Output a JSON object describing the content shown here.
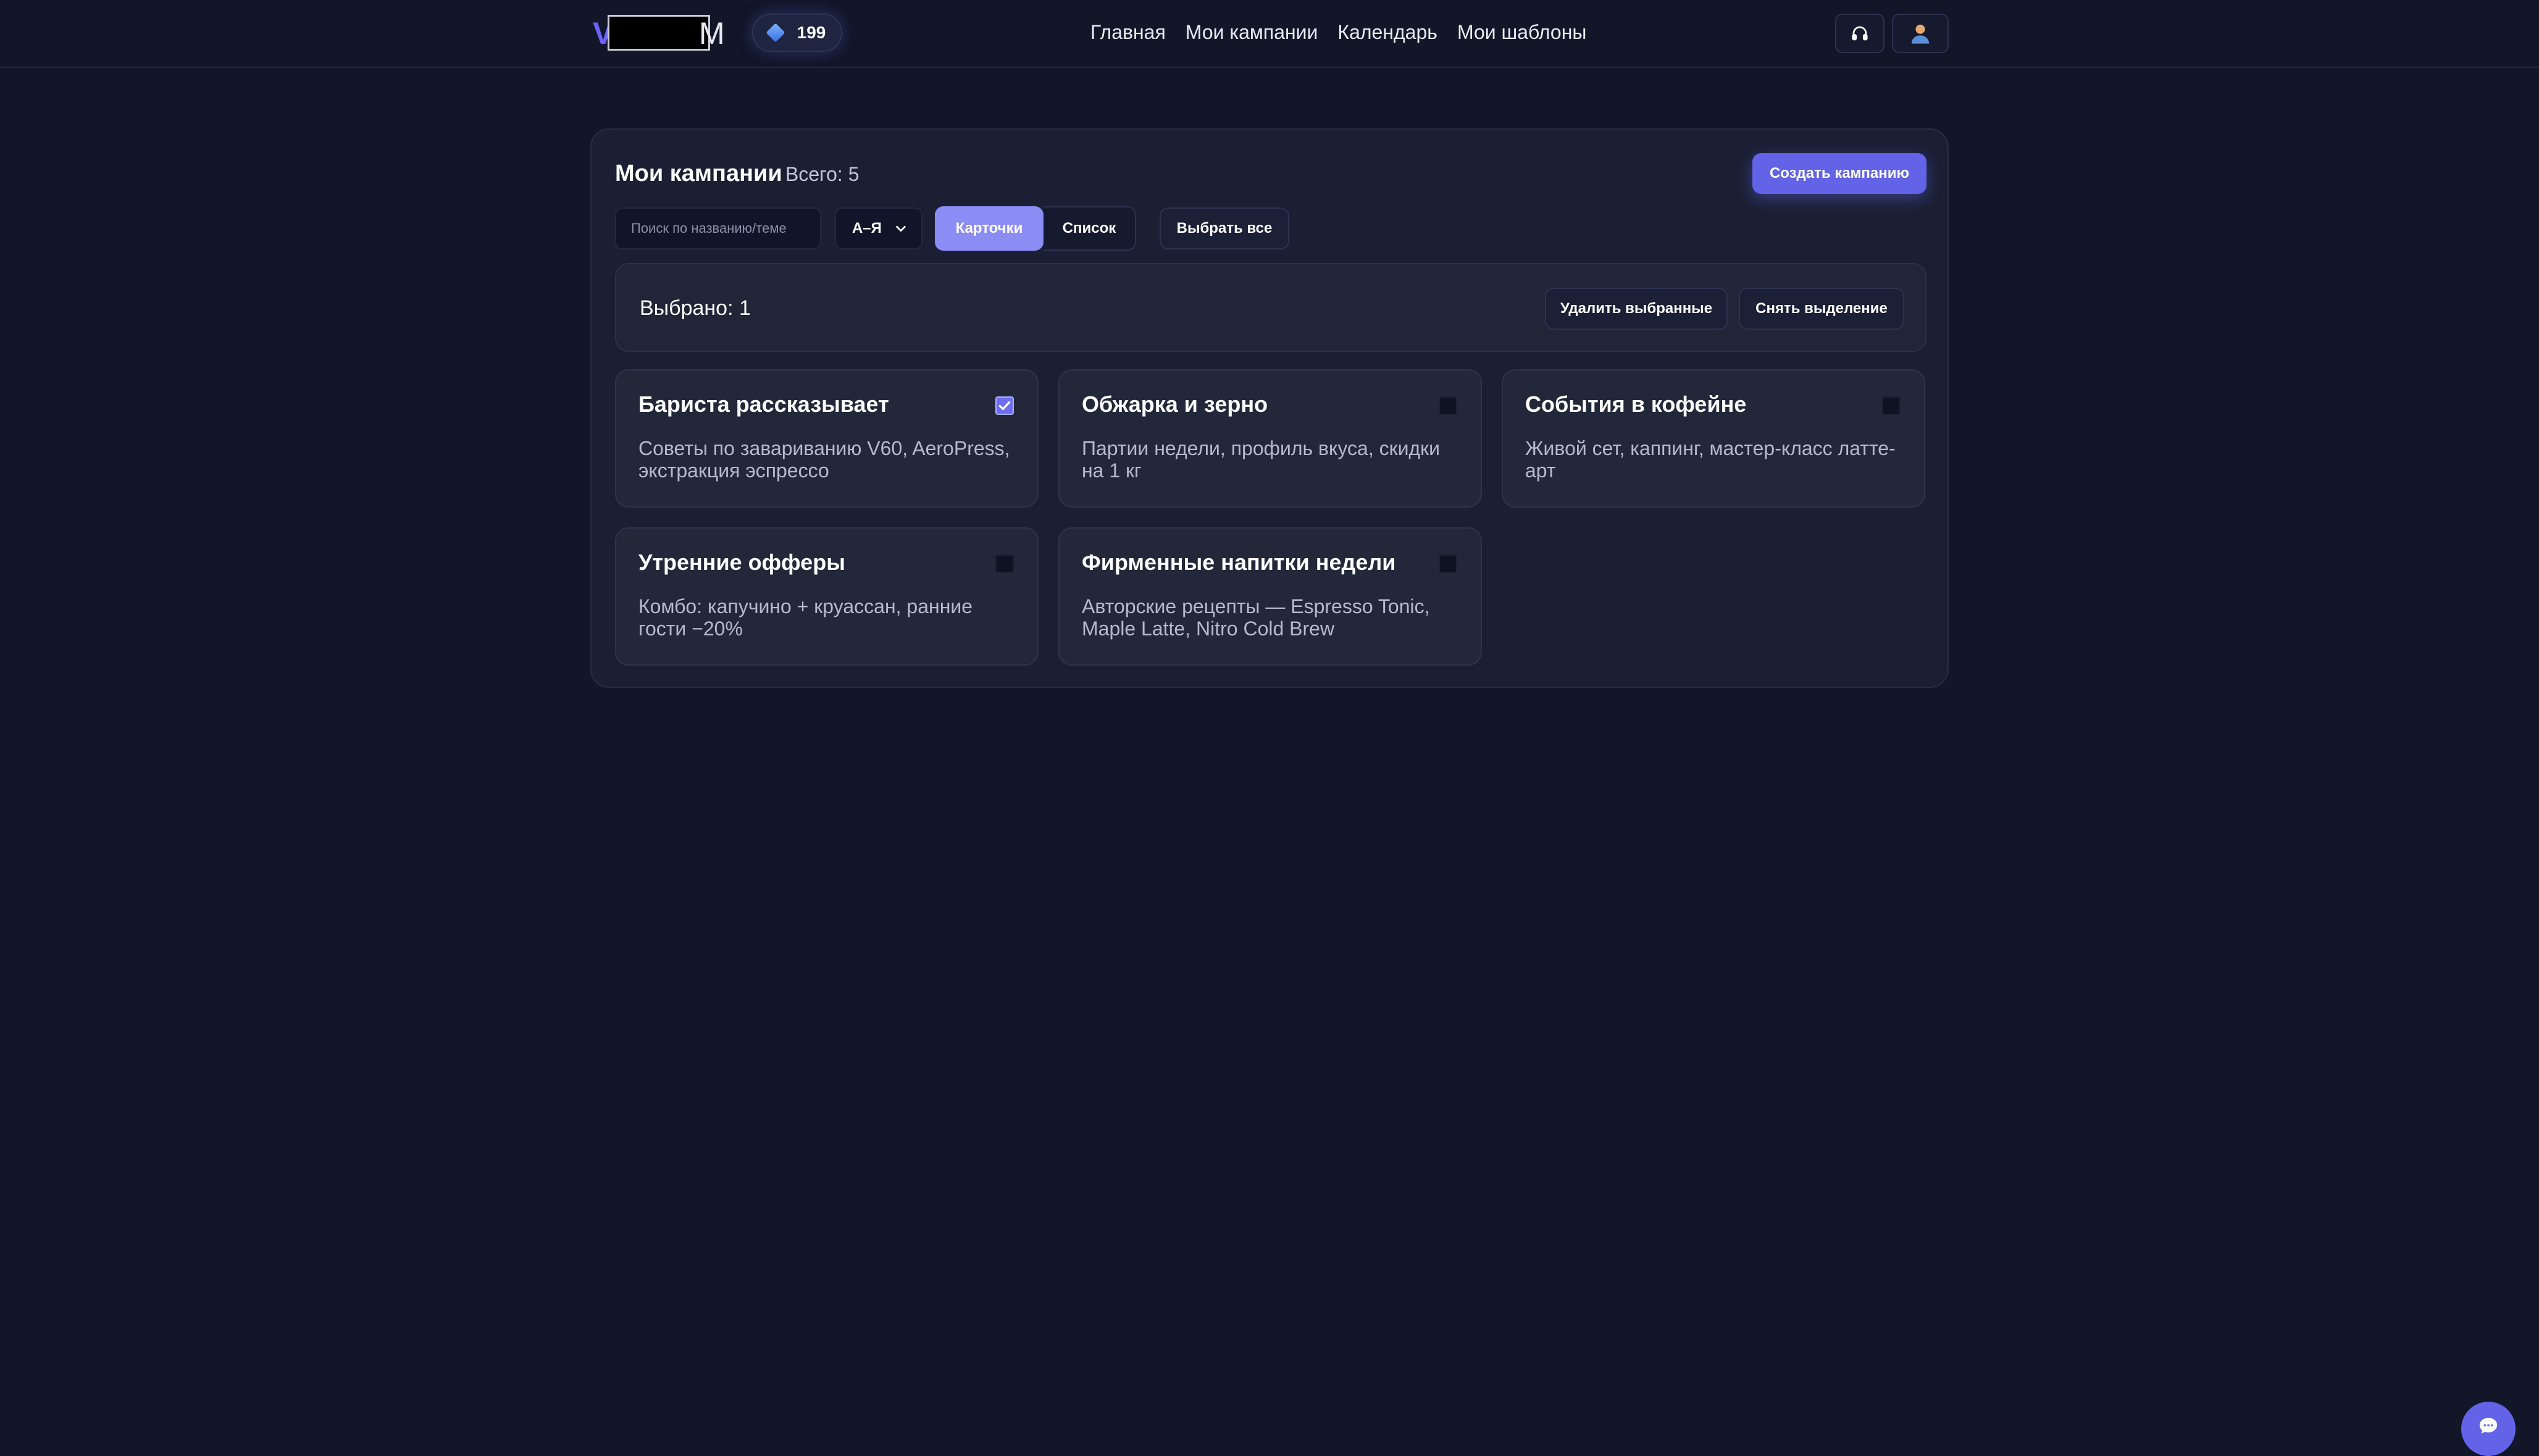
{
  "header": {
    "logo_letter_left": "V",
    "logo_letter_right": "M",
    "balance": "199",
    "nav": [
      "Главная",
      "Мои кампании",
      "Календарь",
      "Мои шаблоны"
    ]
  },
  "campaigns": {
    "title": "Мои кампании",
    "total": "Всего: 5",
    "create_label": "Создать кампанию",
    "search_placeholder": "Поиск по названию/теме",
    "sort_label": "А–Я",
    "view_cards": "Карточки",
    "view_list": "Список",
    "select_all": "Выбрать все",
    "selected_text": "Выбрано: 1",
    "delete_selected": "Удалить выбранные",
    "clear_selection": "Снять выделение",
    "cards": [
      {
        "title": "Бариста рассказывает",
        "desc": "Советы по завариванию V60, AeroPress, экстракция эспрессо",
        "checked": true
      },
      {
        "title": "Обжарка и зерно",
        "desc": "Партии недели, профиль вкуса, скидки на 1 кг",
        "checked": false
      },
      {
        "title": "События в кофейне",
        "desc": "Живой сет, каппинг, мастер-класс латте-арт",
        "checked": false
      },
      {
        "title": "Утренние офферы",
        "desc": "Комбо: капучино + круассан, ранние гости −20%",
        "checked": false
      },
      {
        "title": "Фирменные напитки недели",
        "desc": "Авторские рецепты — Espresso Tonic, Maple Latte, Nitro Cold Brew",
        "checked": false
      }
    ]
  },
  "colors": {
    "background": "#121629",
    "accent": "#6263e6",
    "accent_light": "#8b8cf4"
  }
}
